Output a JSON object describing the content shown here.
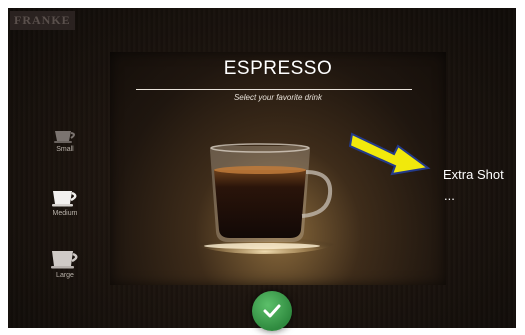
{
  "brand": {
    "name": "FRANKE"
  },
  "drink": {
    "title": "ESPRESSO",
    "subtitle": "Select your favorite drink"
  },
  "sizes": [
    {
      "label": "Small",
      "icon": "cup-small-icon"
    },
    {
      "label": "Medium",
      "icon": "cup-medium-icon"
    },
    {
      "label": "Large",
      "icon": "cup-large-icon"
    }
  ],
  "annotation": {
    "label": "Extra Shot",
    "ellipsis": "..."
  },
  "confirm": {
    "icon": "check-icon"
  },
  "colors": {
    "confirm": "#2f8a3f",
    "arrow": "#f1e90c",
    "arrow_outline": "#233a8c"
  }
}
